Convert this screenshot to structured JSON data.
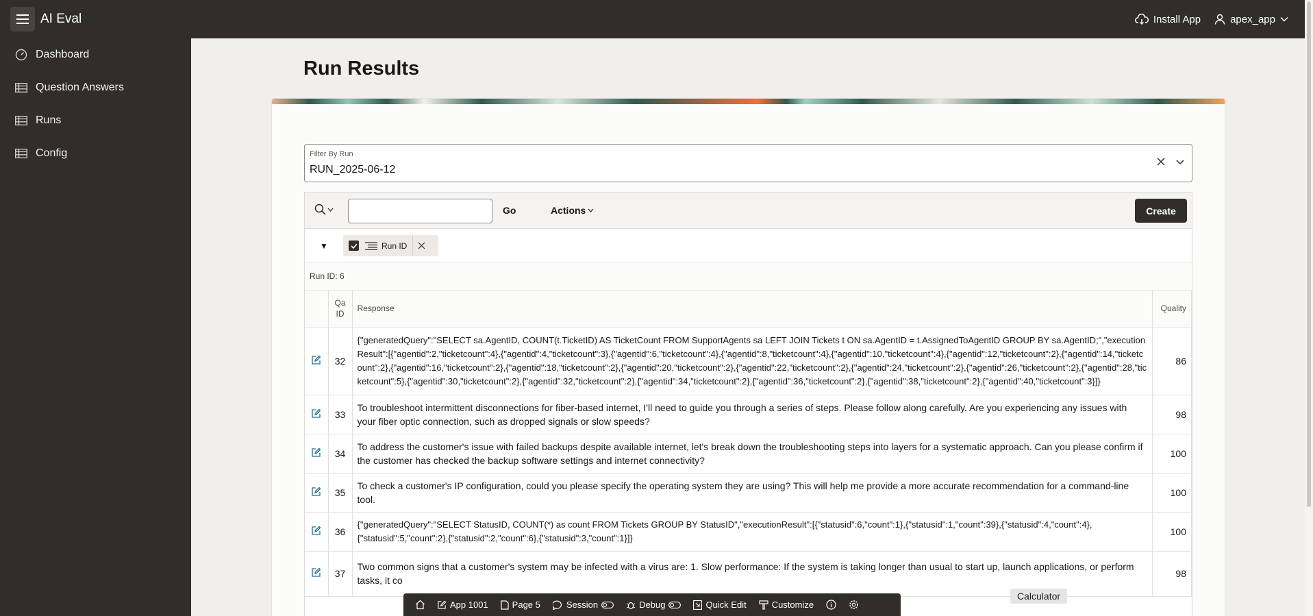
{
  "app": {
    "title": "AI Eval"
  },
  "header": {
    "install_label": "Install App",
    "user_label": "apex_app"
  },
  "sidebar": {
    "items": [
      {
        "label": "Dashboard",
        "icon": "gauge-icon"
      },
      {
        "label": "Question Answers",
        "icon": "table-icon"
      },
      {
        "label": "Runs",
        "icon": "table-icon"
      },
      {
        "label": "Config",
        "icon": "table-icon"
      }
    ]
  },
  "page": {
    "title": "Run Results"
  },
  "filter": {
    "label": "Filter By Run",
    "value": "RUN_2025-06-12"
  },
  "toolbar": {
    "go_label": "Go",
    "actions_label": "Actions",
    "create_label": "Create",
    "search_value": ""
  },
  "report_filter": {
    "chip_label": "Run ID"
  },
  "control_break": {
    "label": "Run ID: 6"
  },
  "table": {
    "headers": {
      "qa_id_line1": "Qa",
      "qa_id_line2": "ID",
      "response": "Response",
      "quality": "Quality"
    },
    "rows": [
      {
        "qa_id": "32",
        "response": "{\"generatedQuery\":\"SELECT sa.AgentID, COUNT(t.TicketID) AS TicketCount FROM SupportAgents sa LEFT JOIN Tickets t ON sa.AgentID = t.AssignedToAgentID GROUP BY sa.AgentID;\",\"executionResult\":[{\"agentid\":2,\"ticketcount\":4},{\"agentid\":4,\"ticketcount\":3},{\"agentid\":6,\"ticketcount\":4},{\"agentid\":8,\"ticketcount\":4},{\"agentid\":10,\"ticketcount\":4},{\"agentid\":12,\"ticketcount\":2},{\"agentid\":14,\"ticketcount\":2},{\"agentid\":16,\"ticketcount\":2},{\"agentid\":18,\"ticketcount\":2},{\"agentid\":20,\"ticketcount\":2},{\"agentid\":22,\"ticketcount\":2},{\"agentid\":24,\"ticketcount\":2},{\"agentid\":26,\"ticketcount\":2},{\"agentid\":28,\"ticketcount\":5},{\"agentid\":30,\"ticketcount\":2},{\"agentid\":32,\"ticketcount\":2},{\"agentid\":34,\"ticketcount\":2},{\"agentid\":36,\"ticketcount\":2},{\"agentid\":38,\"ticketcount\":2},{\"agentid\":40,\"ticketcount\":3}]}",
        "quality": "86"
      },
      {
        "qa_id": "33",
        "response": "To troubleshoot intermittent disconnections for fiber-based internet, I'll need to guide you through a series of steps. Please follow along carefully. Are you experiencing any issues with your fiber optic connection, such as dropped signals or slow speeds?",
        "quality": "98"
      },
      {
        "qa_id": "34",
        "response": "To address the customer's issue with failed backups despite available internet, let's break down the troubleshooting steps into layers for a systematic approach. Can you please confirm if the customer has checked the backup software settings and internet connectivity?",
        "quality": "100"
      },
      {
        "qa_id": "35",
        "response": "To check a customer's IP configuration, could you please specify the operating system they are using? This will help me provide a more accurate recommendation for a command-line tool.",
        "quality": "100"
      },
      {
        "qa_id": "36",
        "response": "{\"generatedQuery\":\"SELECT StatusID, COUNT(*) as count FROM Tickets GROUP BY StatusID\",\"executionResult\":[{\"statusid\":6,\"count\":1},{\"statusid\":1,\"count\":39},{\"statusid\":4,\"count\":4},{\"statusid\":5,\"count\":2},{\"statusid\":2,\"count\":6},{\"statusid\":3,\"count\":1}]}",
        "quality": "100"
      },
      {
        "qa_id": "37",
        "response": "Two common signs that a customer's system may be infected with a virus are: 1. Slow performance: If the system is taking longer than usual to start up, launch applications, or perform tasks, it co",
        "quality": "98"
      }
    ]
  },
  "devbar": {
    "items": [
      "App 1001",
      "Page 5",
      "Session",
      "Debug",
      "Quick Edit",
      "Customize"
    ]
  },
  "tooltip": {
    "label": "Calculator"
  }
}
